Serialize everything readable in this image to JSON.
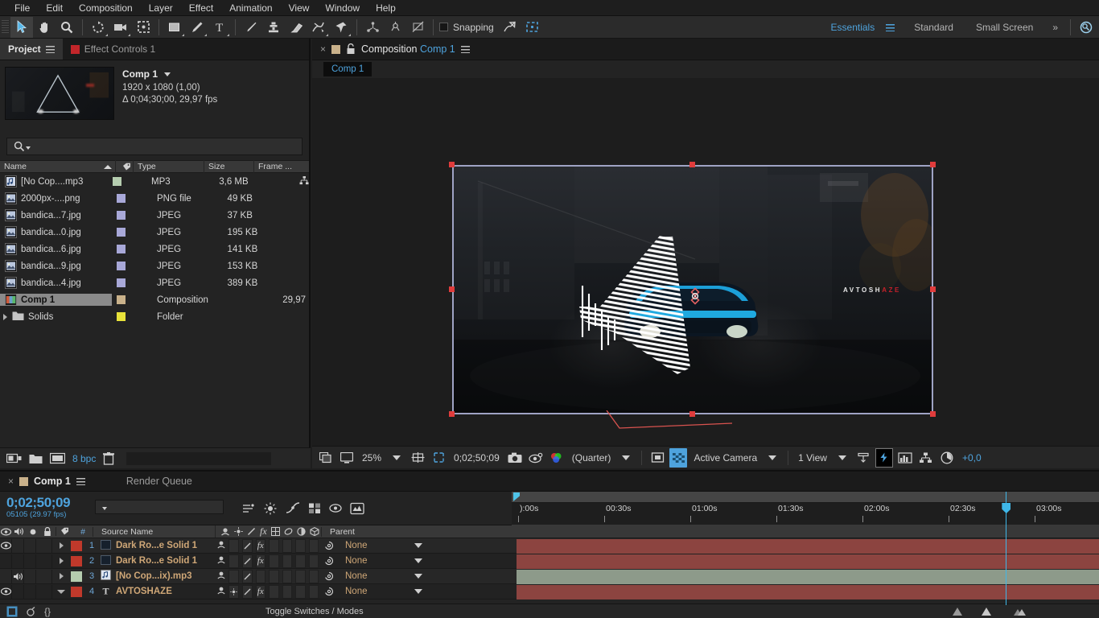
{
  "menubar": {
    "items": [
      "File",
      "Edit",
      "Composition",
      "Layer",
      "Effect",
      "Animation",
      "View",
      "Window",
      "Help"
    ]
  },
  "toolbar": {
    "tools": [
      {
        "name": "selection-tool",
        "active": true
      },
      {
        "name": "hand-tool",
        "active": false
      },
      {
        "name": "zoom-tool",
        "active": false
      },
      {
        "name": "rotation-tool",
        "active": false
      },
      {
        "name": "camera-tool",
        "active": false
      },
      {
        "name": "pan-behind-tool",
        "active": false
      },
      {
        "name": "shape-tool",
        "active": false
      },
      {
        "name": "pen-tool",
        "active": false
      },
      {
        "name": "type-tool",
        "active": false
      },
      {
        "name": "brush-tool",
        "active": false
      },
      {
        "name": "clone-stamp-tool",
        "active": false
      },
      {
        "name": "eraser-tool",
        "active": false
      },
      {
        "name": "roto-brush-tool",
        "active": false
      },
      {
        "name": "puppet-pin-tool",
        "active": false
      }
    ],
    "snapping_label": "Snapping",
    "snapping_checked": false,
    "workspaces": [
      {
        "label": "Essentials",
        "selected": true
      },
      {
        "label": "Standard",
        "selected": false
      },
      {
        "label": "Small Screen",
        "selected": false
      }
    ],
    "overflow_label": "»"
  },
  "project": {
    "tabs": [
      {
        "label": "Project",
        "active": true
      },
      {
        "label": "Effect Controls 1",
        "active": false
      }
    ],
    "selected_item": {
      "name": "Comp 1",
      "dimensions": "1920 x 1080 (1,00)",
      "duration": "Δ 0;04;30;00, 29,97 fps"
    },
    "search_placeholder": "",
    "columns": [
      "Name",
      "Type",
      "Size",
      "Frame ..."
    ],
    "items": [
      {
        "name": "[No Cop....mp3",
        "type": "MP3",
        "size": "3,6 MB",
        "frame": "",
        "color": "#b5cdaf",
        "icon": "audio-file-icon",
        "selected": false,
        "has_link": true
      },
      {
        "name": "2000px-....png",
        "type": "PNG file",
        "size": "49 KB",
        "frame": "",
        "color": "#a8a8d8",
        "icon": "image-file-icon",
        "selected": false,
        "has_link": false
      },
      {
        "name": "bandica...7.jpg",
        "type": "JPEG",
        "size": "37 KB",
        "frame": "",
        "color": "#a8a8d8",
        "icon": "image-file-icon",
        "selected": false,
        "has_link": false
      },
      {
        "name": "bandica...0.jpg",
        "type": "JPEG",
        "size": "195 KB",
        "frame": "",
        "color": "#a8a8d8",
        "icon": "image-file-icon",
        "selected": false,
        "has_link": false
      },
      {
        "name": "bandica...6.jpg",
        "type": "JPEG",
        "size": "141 KB",
        "frame": "",
        "color": "#a8a8d8",
        "icon": "image-file-icon",
        "selected": false,
        "has_link": false
      },
      {
        "name": "bandica...9.jpg",
        "type": "JPEG",
        "size": "153 KB",
        "frame": "",
        "color": "#a8a8d8",
        "icon": "image-file-icon",
        "selected": false,
        "has_link": false
      },
      {
        "name": "bandica...4.jpg",
        "type": "JPEG",
        "size": "389 KB",
        "frame": "",
        "color": "#a8a8d8",
        "icon": "image-file-icon",
        "selected": false,
        "has_link": false
      },
      {
        "name": "Comp 1",
        "type": "Composition",
        "size": "",
        "frame": "29,97",
        "color": "#c9b18a",
        "icon": "composition-icon",
        "selected": true,
        "has_link": false
      },
      {
        "name": "Solids",
        "type": "Folder",
        "size": "",
        "frame": "",
        "color": "#e8e23a",
        "icon": "folder-icon",
        "selected": false,
        "has_link": false
      }
    ],
    "footer": {
      "bit_depth": "8 bpc"
    }
  },
  "composition": {
    "tab_prefix": "Composition",
    "tab_name": "Comp 1",
    "breadcrumb": "Comp 1",
    "canvas": {
      "watermark_white": "AVTOSH",
      "watermark_red": "AZE"
    },
    "bottom_bar": {
      "zoom": "25%",
      "timecode": "0;02;50;09",
      "resolution": "(Quarter)",
      "camera": "Active Camera",
      "views": "1 View",
      "exposure": "+0,0"
    }
  },
  "timeline": {
    "tabs": [
      {
        "label": "Comp 1",
        "active": true
      },
      {
        "label": "Render Queue",
        "active": false
      }
    ],
    "timecode": "0;02;50;09",
    "frame_info": "05105 (29.97 fps)",
    "search_placeholder": "",
    "columns": {
      "num": "#",
      "source_name": "Source Name",
      "parent": "Parent"
    },
    "ruler_labels": [
      "):00s",
      "00:30s",
      "01:00s",
      "01:30s",
      "02:00s",
      "02:30s",
      "03:00s"
    ],
    "layers": [
      {
        "num": "1",
        "name": "Dark Ro...e Solid 1",
        "parent": "None",
        "color": "#c0392b",
        "visible": true,
        "audio": false,
        "expanded": false,
        "icon": "solid-layer-icon",
        "bar_color": "#8c4440"
      },
      {
        "num": "2",
        "name": "Dark Ro...e Solid 1",
        "parent": "None",
        "color": "#c0392b",
        "visible": false,
        "audio": false,
        "expanded": false,
        "icon": "solid-layer-icon",
        "bar_color": "#8c4440"
      },
      {
        "num": "3",
        "name": "[No Cop...ix).mp3",
        "parent": "None",
        "color": "#b5cdaf",
        "visible": false,
        "audio": true,
        "expanded": false,
        "icon": "audio-layer-icon",
        "bar_color": "#8d9a8a"
      },
      {
        "num": "4",
        "name": "AVTOSHAZE",
        "parent": "None",
        "color": "#c0392b",
        "visible": true,
        "audio": false,
        "expanded": true,
        "icon": "text-layer-icon",
        "bar_color": "#8c4440"
      }
    ],
    "footer": {
      "toggle_label": "Toggle Switches / Modes"
    }
  },
  "colors": {
    "accent_blue": "#4ea3dd",
    "panel_bg": "#232323",
    "label_orange": "#cfa777",
    "selection_red": "#e03c3c"
  }
}
